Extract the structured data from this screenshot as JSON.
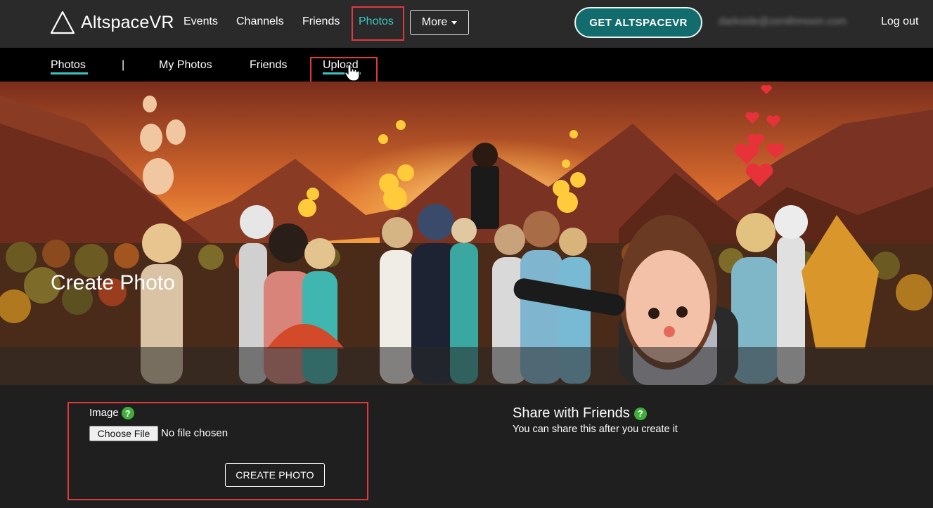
{
  "brand": {
    "name": "AltspaceVR",
    "accent": "#3cc6c3",
    "button_teal": "#126b6c",
    "highlight_red": "#e0393e"
  },
  "topnav": {
    "links": [
      "Events",
      "Channels",
      "Friends",
      "Photos"
    ],
    "active": "Photos",
    "more_label": "More",
    "get_label": "GET ALTSPACEVR",
    "account_email": "darkside@zenithmoon.com",
    "logout_label": "Log out"
  },
  "subnav": {
    "items": [
      "Photos",
      "|",
      "My Photos",
      "Friends",
      "Upload"
    ],
    "active": "Photos"
  },
  "hero": {
    "title": "Create Photo",
    "image": "event-crowd-scene"
  },
  "form": {
    "image_label": "Image",
    "help_icon": "?",
    "choose_file_label": "Choose File",
    "no_file_text": "No file chosen",
    "create_label": "CREATE PHOTO"
  },
  "share": {
    "title": "Share with Friends",
    "help_icon": "?",
    "subtitle": "You can share this after you create it"
  }
}
